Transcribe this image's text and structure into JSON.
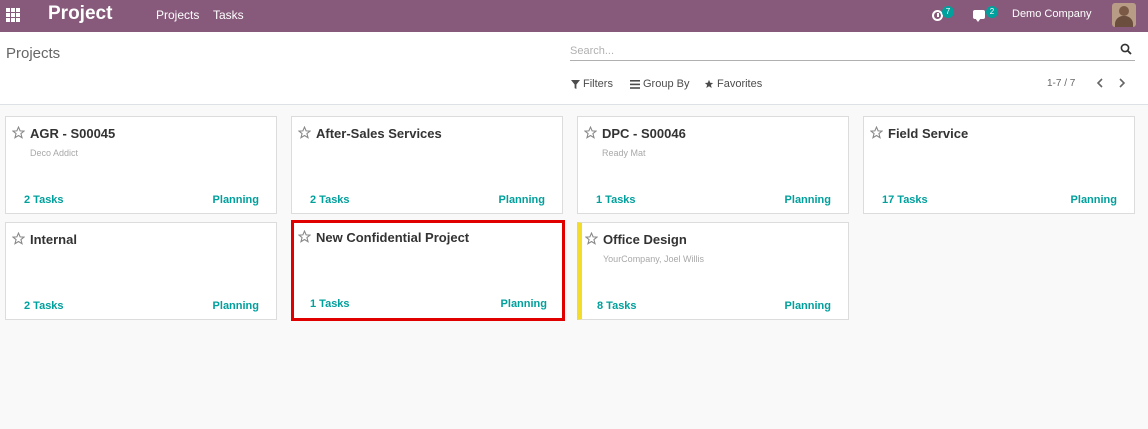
{
  "navbar": {
    "app_name": "Project",
    "menu": [
      "Projects",
      "Tasks"
    ],
    "activity_count": "7",
    "messages_count": "2",
    "company": "Demo Company",
    "bg_color": "#875a7b"
  },
  "control_panel": {
    "title": "Projects",
    "search_placeholder": "Search...",
    "filters_label": "Filters",
    "groupby_label": "Group By",
    "favorites_label": "Favorites",
    "pager": "1-7 / 7"
  },
  "projects": [
    {
      "name": "AGR - S00045",
      "subtitle": "Deco Addict",
      "tasks": "2 Tasks",
      "planning": "Planning"
    },
    {
      "name": "After-Sales Services",
      "subtitle": "",
      "tasks": "2 Tasks",
      "planning": "Planning"
    },
    {
      "name": "DPC - S00046",
      "subtitle": "Ready Mat",
      "tasks": "1 Tasks",
      "planning": "Planning"
    },
    {
      "name": "Field Service",
      "subtitle": "",
      "tasks": "17 Tasks",
      "planning": "Planning"
    },
    {
      "name": "Internal",
      "subtitle": "",
      "tasks": "2 Tasks",
      "planning": "Planning"
    },
    {
      "name": "New Confidential Project",
      "subtitle": "",
      "tasks": "1 Tasks",
      "planning": "Planning",
      "highlighted": true
    },
    {
      "name": "Office Design",
      "subtitle": "YourCompany, Joel Willis",
      "tasks": "8 Tasks",
      "planning": "Planning",
      "color": "#f4dc2b"
    }
  ],
  "colors": {
    "accent": "#00a09d",
    "highlight_border": "#e00000"
  }
}
